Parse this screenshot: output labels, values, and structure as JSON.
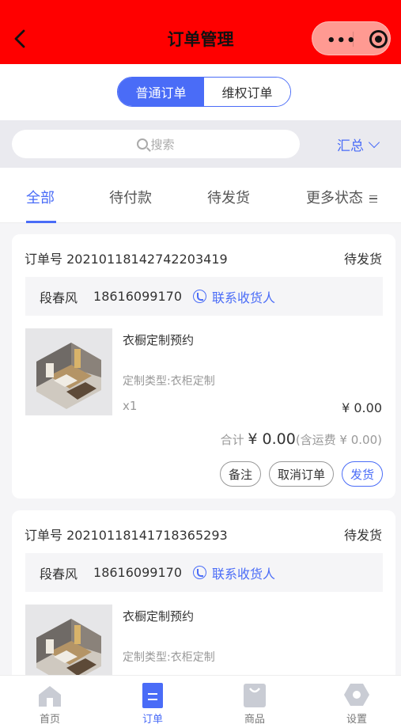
{
  "header": {
    "title": "订单管理",
    "menu_dots": "•••"
  },
  "segment": {
    "options": [
      "普通订单",
      "维权订单"
    ],
    "selected": "普通订单"
  },
  "search": {
    "placeholder": "搜索",
    "summary_label": "汇总"
  },
  "tabs": {
    "items": [
      "全部",
      "待付款",
      "待发货",
      "更多状态"
    ],
    "active": "全部"
  },
  "orders": [
    {
      "order_label": "订单号 20210118142742203419",
      "status": "待发货",
      "name": "段春风",
      "phone": "18616099170",
      "contact_label": "联系收货人",
      "product_name": "衣橱定制预约",
      "product_type": "定制类型:衣柜定制",
      "qty": "x1",
      "price": "¥ 0.00",
      "total_prefix": "合计",
      "total_amount": "¥ 0.00",
      "total_suffix": "(含运费 ¥ 0.00)",
      "actions": [
        "备注",
        "取消订单",
        "发货"
      ]
    },
    {
      "order_label": "订单号 20210118141718365293",
      "status": "待发货",
      "name": "段春风",
      "phone": "18616099170",
      "contact_label": "联系收货人",
      "product_name": "衣橱定制预约",
      "product_type": "定制类型:衣柜定制"
    }
  ],
  "tabbar": {
    "items": [
      {
        "label": "首页",
        "icon": "home-icon"
      },
      {
        "label": "订单",
        "icon": "order-icon"
      },
      {
        "label": "商品",
        "icon": "bag-icon"
      },
      {
        "label": "设置",
        "icon": "settings-icon"
      }
    ],
    "active": "订单"
  },
  "colors": {
    "header_bg": "#ff0000",
    "accent": "#4a6cf7",
    "capsule_bg": "#ff9a92"
  }
}
